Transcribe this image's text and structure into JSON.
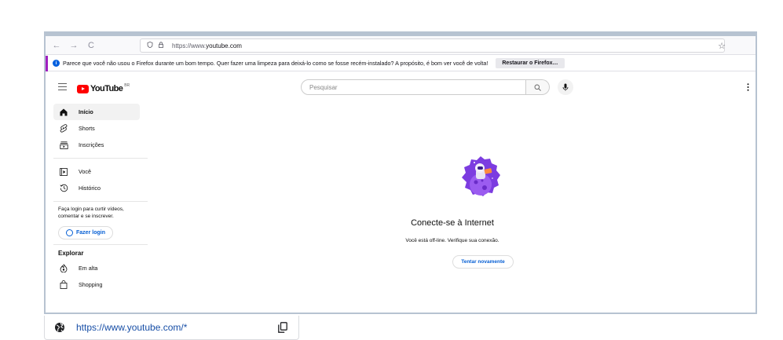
{
  "browser": {
    "url_prefix": "https://www.",
    "url_domain": "youtube.com",
    "nav_back": "←",
    "nav_forward": "→",
    "nav_reload": "C"
  },
  "notification": {
    "message": "Parece que você não usou o Firefox durante um bom tempo. Quer fazer uma limpeza para deixá-lo como se fosse recém-instalado? A propósito, é bom ver você de volta!",
    "button": "Restaurar o Firefox…"
  },
  "youtube": {
    "logo_text": "YouTube",
    "region": "BR",
    "search_placeholder": "Pesquisar"
  },
  "sidebar": {
    "items": [
      {
        "label": "Início"
      },
      {
        "label": "Shorts"
      },
      {
        "label": "Inscrições"
      }
    ],
    "items2": [
      {
        "label": "Você"
      },
      {
        "label": "Histórico"
      }
    ],
    "login_prompt": "Faça login para curtir vídeos, comentar e se inscrever.",
    "login_button": "Fazer login",
    "explore_heading": "Explorar",
    "explore_items": [
      {
        "label": "Em alta"
      },
      {
        "label": "Shopping"
      }
    ]
  },
  "offline": {
    "title": "Conecte-se à Internet",
    "subtitle": "Você está off-line. Verifique sua conexão.",
    "retry": "Tentar novamente"
  },
  "footer": {
    "url": "https://www.youtube.com/*"
  },
  "colors": {
    "youtube_red": "#ff0000",
    "link_blue": "#065fd4",
    "notif_accent": "#a020c0",
    "frame_border": "#b7c3d1"
  }
}
